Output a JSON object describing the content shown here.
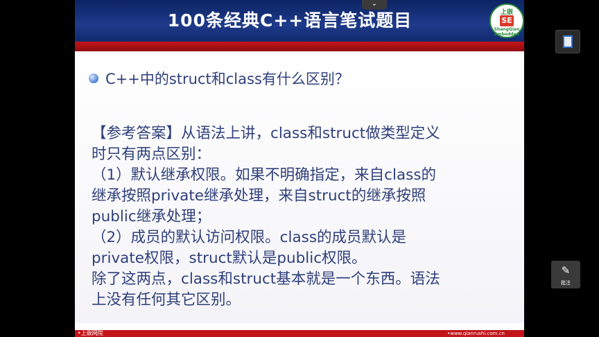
{
  "slide": {
    "title": "100条经典C++语言笔试题目",
    "logo": {
      "top_char": "上嵌",
      "mid_chars": "SE",
      "ring_text": "ShangQian Embedded"
    },
    "question": "C++中的struct和class有什么区别？",
    "answer_lines": [
      "【参考答案】从语法上讲，class和struct做类型定义",
      "时只有两点区别：",
      "（1）默认继承权限。如果不明确指定，来自class的",
      "继承按照private继承处理，来自struct的继承按照",
      "public继承处理；",
      "（2）成员的默认访问权限。class的成员默认是",
      "private权限，struct默认是public权限。",
      "除了这两点，class和struct基本就是一个东西。语法",
      "上没有任何其它区别。"
    ],
    "footer_left": "•上嵌网院",
    "footer_right": "•www.qianrushi.com.cn"
  },
  "player": {
    "collapse_icon": "chevron-down-icon",
    "office_icon": "office-icon",
    "annotate_label": "批注"
  },
  "colors": {
    "header": "#1e3a8a",
    "accent_red": "#c21419",
    "text": "#2f3f7a"
  }
}
